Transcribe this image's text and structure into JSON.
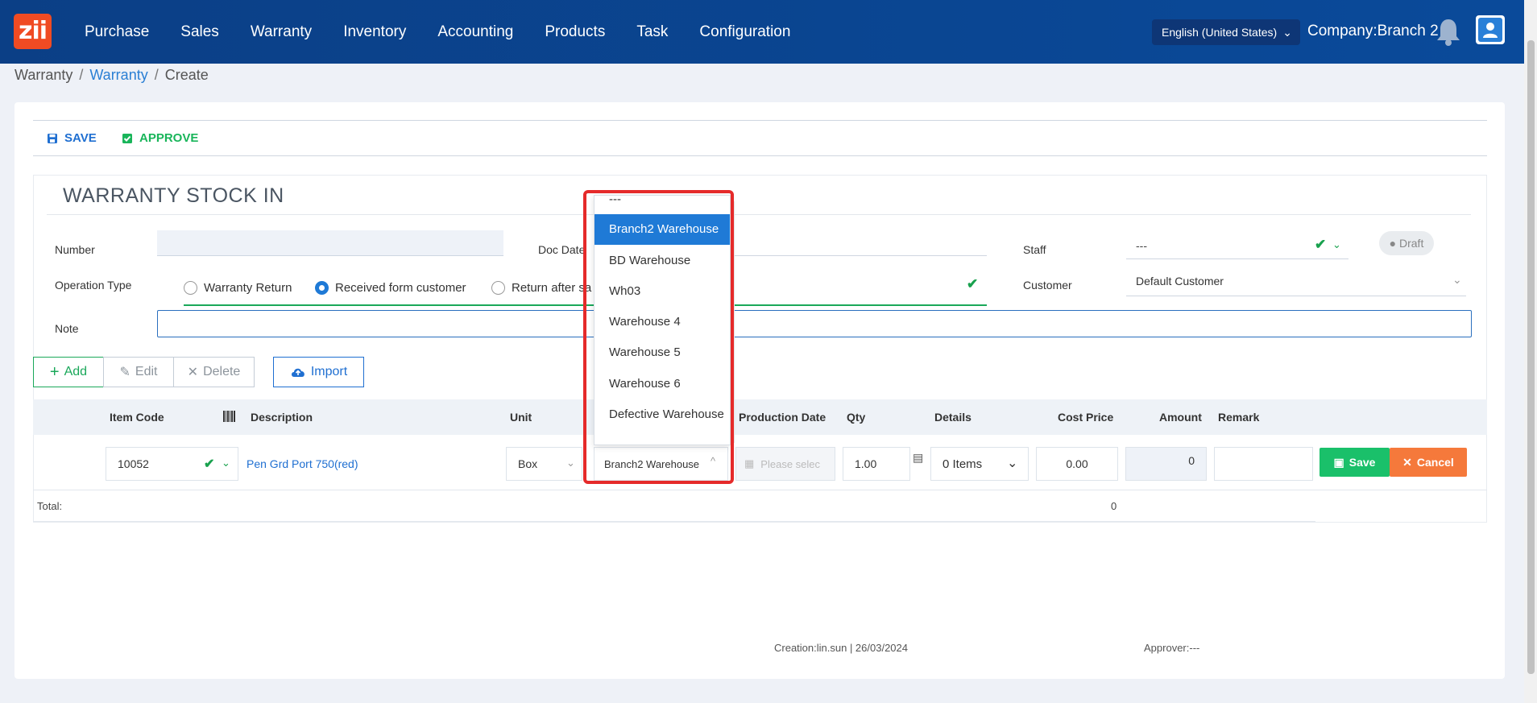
{
  "topbar": {
    "logo": "zii",
    "nav": [
      "Purchase",
      "Sales",
      "Warranty",
      "Inventory",
      "Accounting",
      "Products",
      "Task",
      "Configuration"
    ],
    "language": "English (United States)",
    "company": "Company:Branch 2"
  },
  "breadcrumb": {
    "root": "Warranty",
    "link": "Warranty",
    "current": "Create",
    "sep": "/"
  },
  "toolbar": {
    "save": "SAVE",
    "approve": "APPROVE"
  },
  "form": {
    "title": "WARRANTY STOCK IN",
    "number_label": "Number",
    "docdate_label": "Doc Date",
    "staff_label": "Staff",
    "staff_value": "---",
    "status": "Draft",
    "optype_label": "Operation Type",
    "radios": [
      "Warranty Return",
      "Received form customer",
      "Return after sa"
    ],
    "customer_label": "Customer",
    "customer_value": "Default Customer",
    "note_label": "Note"
  },
  "actions": {
    "add": "Add",
    "edit": "Edit",
    "delete": "Delete",
    "import": "Import"
  },
  "table": {
    "headers": [
      "Item Code",
      "Description",
      "Unit",
      "Production Date",
      "Qty",
      "Details",
      "Cost Price",
      "Amount",
      "Remark"
    ],
    "row": {
      "item_code": "10052",
      "description": "Pen Grd Port 750(red)",
      "unit": "Box",
      "warehouse": "Branch2 Warehouse",
      "production_date_placeholder": "Please selec",
      "qty": "1.00",
      "details": "0 Items",
      "cost_price": "0.00",
      "amount": "0",
      "save": "Save",
      "cancel": "Cancel"
    },
    "total_label": "Total:",
    "total_value": "0"
  },
  "footer": {
    "creation": "Creation:lin.sun | 26/03/2024",
    "approver": "Approver:---"
  },
  "dropdown": {
    "items": [
      "---",
      "Branch2 Warehouse",
      "BD Warehouse",
      "Wh03",
      "Warehouse 4",
      "Warehouse 5",
      "Warehouse 6",
      "Defective Warehouse"
    ],
    "selected": "Branch2 Warehouse"
  },
  "colors": {
    "brand": "#0b3f86",
    "accent": "#1f7ad6",
    "success": "#1ac06a",
    "danger": "#f5793b",
    "highlight": "#e52a2a"
  }
}
